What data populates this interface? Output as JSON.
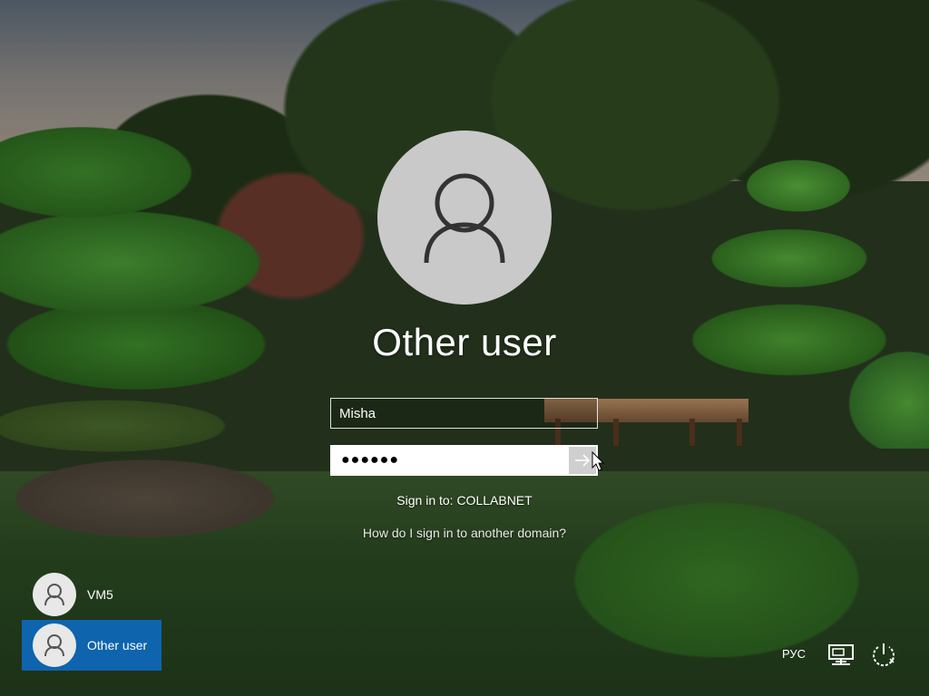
{
  "login": {
    "title": "Other user",
    "username_value": "Misha",
    "password_mask": "●●●●●●",
    "sign_in_to": "Sign in to: COLLABNET",
    "domain_help": "How do I sign in to another domain?"
  },
  "users": [
    {
      "name": "VM5",
      "selected": false
    },
    {
      "name": "Other user",
      "selected": true
    }
  ],
  "tray": {
    "language": "РУС",
    "network_icon": "network-icon",
    "power_icon": "power-icon"
  },
  "colors": {
    "selected_tile": "#0e64ad",
    "avatar_bg": "#c9c9c9"
  }
}
